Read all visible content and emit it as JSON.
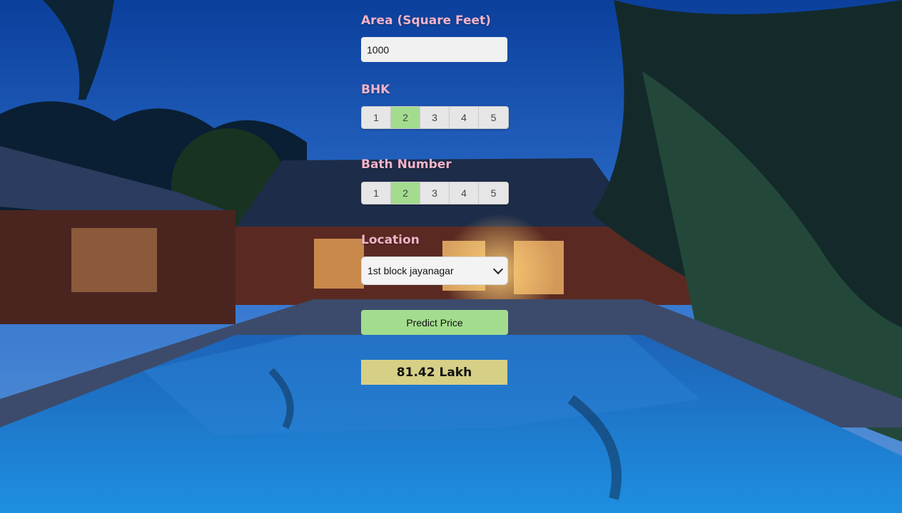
{
  "form": {
    "area_label": "Area (Square Feet)",
    "area_value": "1000",
    "bhk_label": "BHK",
    "bhk_options": [
      "1",
      "2",
      "3",
      "4",
      "5"
    ],
    "bhk_selected": "2",
    "bath_label": "Bath Number",
    "bath_options": [
      "1",
      "2",
      "3",
      "4",
      "5"
    ],
    "bath_selected": "2",
    "location_label": "Location",
    "location_selected": "1st block jayanagar",
    "predict_button": "Predict Price",
    "result": "81.42 Lakh"
  },
  "colors": {
    "label": "#f3b3c9",
    "selected_option": "#a3dc8e",
    "predict_button": "#a3dc8e",
    "result_background": "#d6cf86"
  },
  "background": {
    "description_icon": "villa-pool-night-photo"
  }
}
